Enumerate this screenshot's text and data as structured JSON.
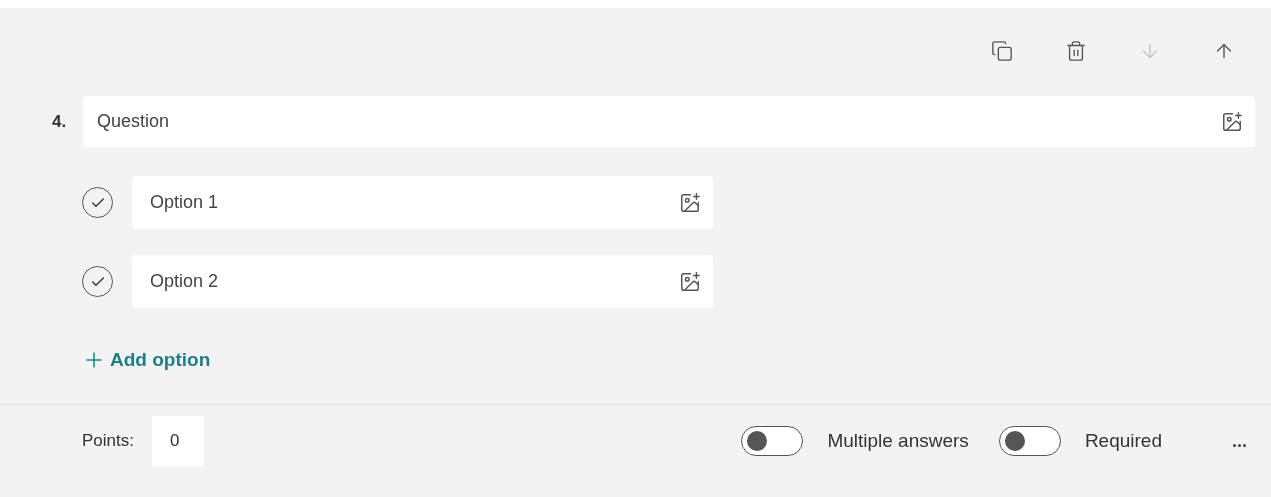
{
  "toolbar": [
    {
      "kind": "copy",
      "disabled": false
    },
    {
      "kind": "delete",
      "disabled": false
    },
    {
      "kind": "down",
      "disabled": true
    },
    {
      "kind": "up",
      "disabled": false
    }
  ],
  "question": {
    "number": "4.",
    "placeholder": "Question"
  },
  "options": [
    {
      "placeholder": "Option 1"
    },
    {
      "placeholder": "Option 2"
    }
  ],
  "add_option": "Add option",
  "footer": {
    "points_label": "Points:",
    "points_value": "0",
    "toggles": [
      {
        "label": "Multiple answers",
        "on": false
      },
      {
        "label": "Required",
        "on": false
      }
    ],
    "more": "..."
  }
}
